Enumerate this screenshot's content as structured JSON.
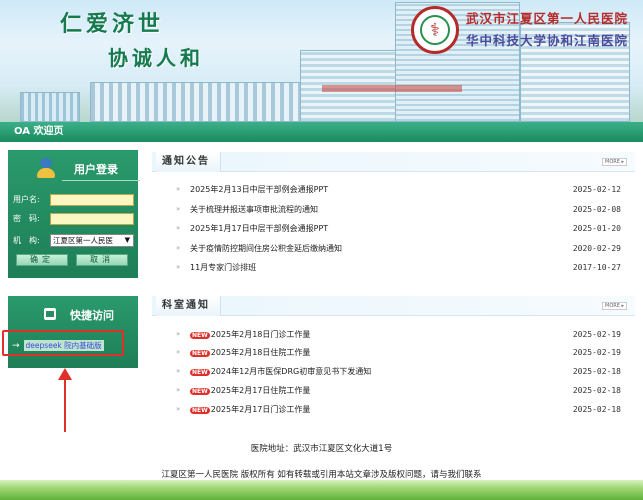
{
  "banner": {
    "slogan_line1": "仁爱济世",
    "slogan_line2": "协诚人和",
    "hospital_name_1": "武汉市江夏区第一人民医院",
    "hospital_name_2": "华中科技大学协和江南医院",
    "logo_glyph": "⚕"
  },
  "titlebar": {
    "label": "OA 欢迎页"
  },
  "login": {
    "title": "用户登录",
    "username_label": "用户名:",
    "username_value": "",
    "password_label": "密　码:",
    "password_value": "",
    "org_label": "机　构:",
    "org_selected": "江夏区第一人民医",
    "confirm_label": "确定",
    "cancel_label": "取消"
  },
  "quick_access": {
    "title": "快捷访问",
    "link_label": "deepseek 院内基础版"
  },
  "notice": {
    "title": "通知公告",
    "more_label": "MORE ▸",
    "items": [
      {
        "title": "2025年2月13日中层干部例会通报PPT",
        "date": "2025-02-12"
      },
      {
        "title": "关于梳理并报送事项审批流程的通知",
        "date": "2025-02-08"
      },
      {
        "title": "2025年1月17日中层干部例会通报PPT",
        "date": "2025-01-20"
      },
      {
        "title": "关于疫情防控期间住房公积金延后缴纳通知",
        "date": "2020-02-29"
      },
      {
        "title": "11月专家门诊排班",
        "date": "2017-10-27"
      }
    ]
  },
  "dept": {
    "title": "科室通知",
    "more_label": "MORE ▸",
    "new_badge": "NEW",
    "items": [
      {
        "title": "2025年2月18日门诊工作量",
        "date": "2025-02-19"
      },
      {
        "title": "2025年2月18日住院工作量",
        "date": "2025-02-19"
      },
      {
        "title": "2024年12月市医保DRG初审意见书下发通知",
        "date": "2025-02-18"
      },
      {
        "title": "2025年2月17日住院工作量",
        "date": "2025-02-18"
      },
      {
        "title": "2025年2月17日门诊工作量",
        "date": "2025-02-18"
      }
    ]
  },
  "footer": {
    "address": "医院地址：武汉市江夏区文化大道1号",
    "copyright": "江夏区第一人民医院 版权所有 如有转载或引用本站文章涉及版权问题，请与我们联系"
  },
  "colors": {
    "brand_green": "#1b8a5f",
    "accent_red": "#e0302a",
    "link_blue": "#3e49d8"
  }
}
